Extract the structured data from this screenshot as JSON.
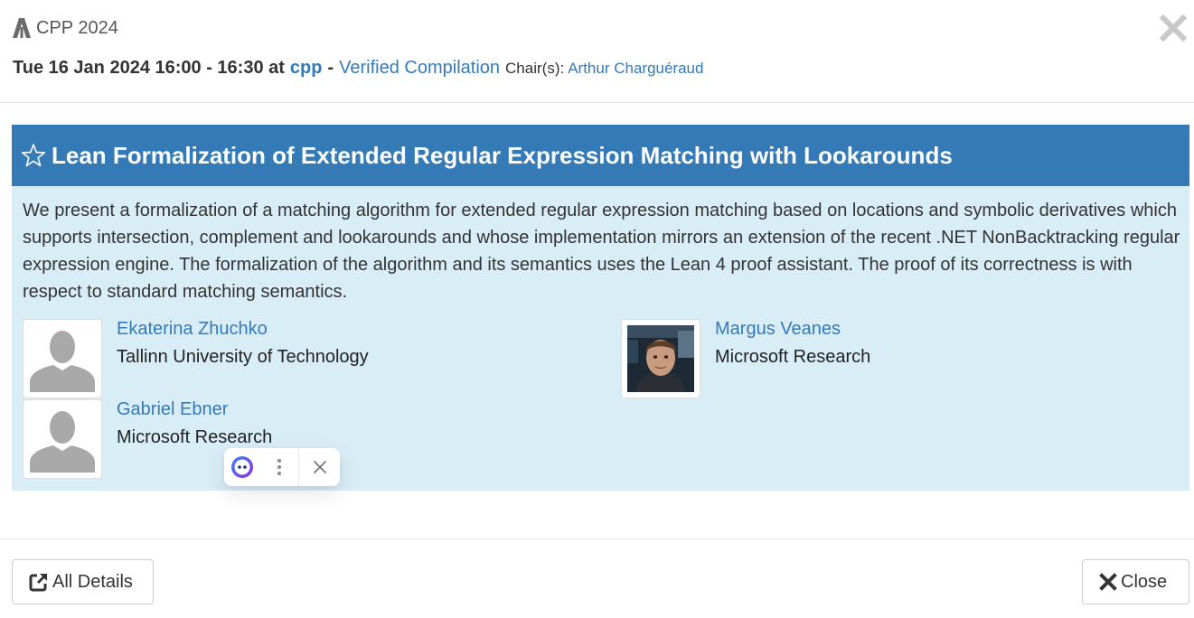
{
  "header": {
    "conference": "CPP 2024",
    "session_time": "Tue 16 Jan 2024 16:00 - 16:30 at",
    "track": "cpp",
    "separator": "-",
    "session_name": "Verified Compilation",
    "chairs_label": "Chair(s):",
    "chair_name": "Arthur Charguéraud"
  },
  "talk": {
    "title": "Lean Formalization of Extended Regular Expression Matching with Lookarounds",
    "abstract": "We present a formalization of a matching algorithm for extended regular expression matching based on locations and symbolic derivatives which supports intersection, complement and lookarounds and whose implementation mirrors an extension of the recent .NET NonBacktracking regular expression engine. The formalization of the algorithm and its semantics uses the Lean 4 proof assistant. The proof of its correctness is with respect to standard matching semantics."
  },
  "authors": [
    {
      "name": "Ekaterina Zhuchko",
      "affiliation": "Tallinn University of Technology",
      "photo": "placeholder-silhouette"
    },
    {
      "name": "Margus Veanes",
      "affiliation": "Microsoft Research",
      "photo": "portrait-photo"
    },
    {
      "name": "Gabriel Ebner",
      "affiliation": "Microsoft Research",
      "photo": "placeholder-silhouette"
    }
  ],
  "footer": {
    "details_label": "All Details",
    "close_label": "Close"
  },
  "icons": {
    "logo": "conference-logo-icon",
    "close": "close-x-icon",
    "star": "star-outline-icon",
    "external": "external-link-icon",
    "times": "times-icon",
    "assistant": "assistant-face-icon",
    "more": "more-vertical-icon",
    "dismiss": "dismiss-icon"
  },
  "colors": {
    "accent": "#337ab7",
    "panel_bg": "#d9edf7",
    "text": "#333333"
  }
}
